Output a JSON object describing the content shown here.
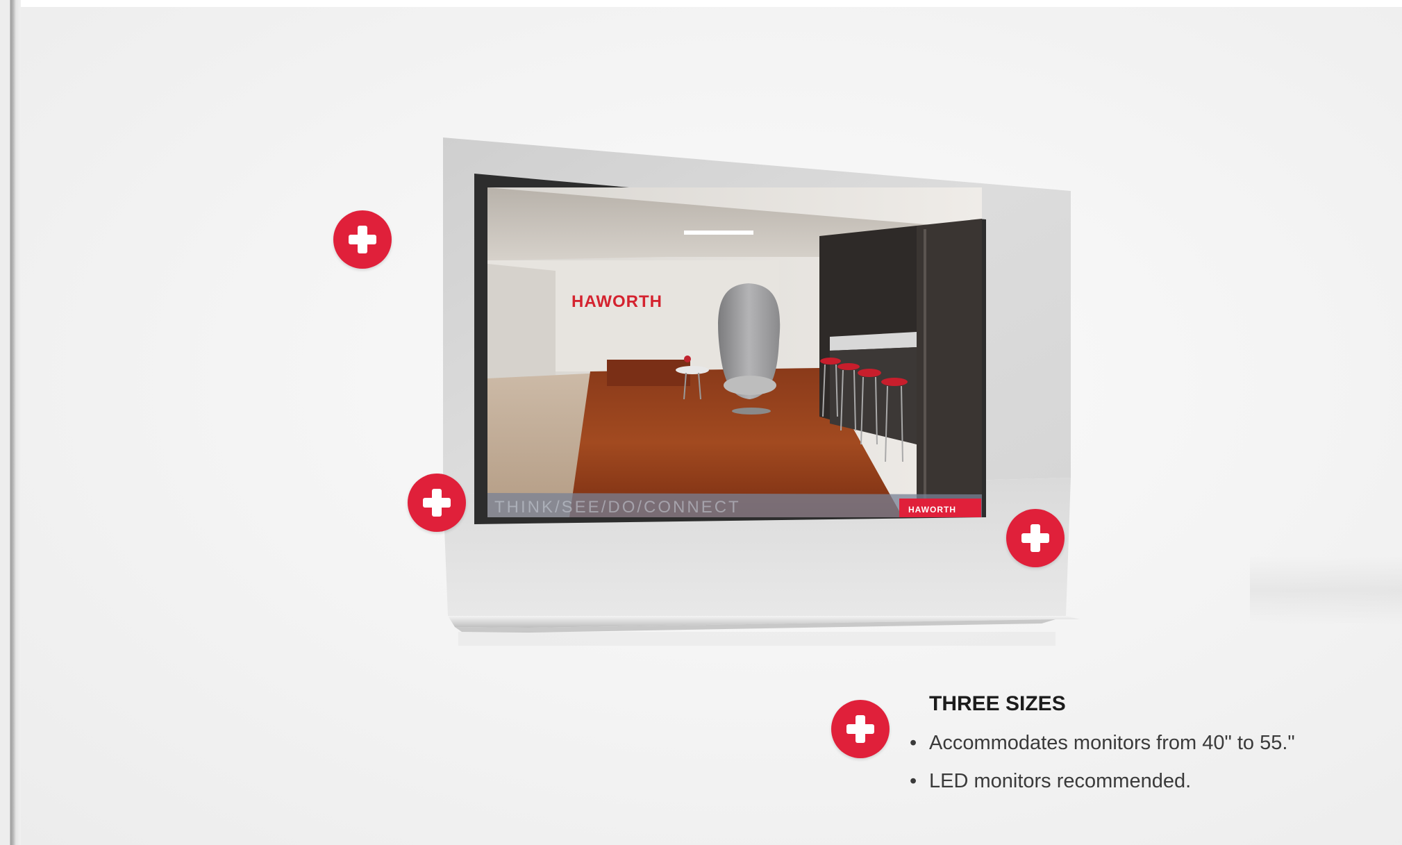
{
  "screen": {
    "colors": {
      "accent": "#e0203a",
      "background": "#f3f3f3",
      "panel": "#d9d9d9",
      "bezel": "#2b2b2b"
    }
  },
  "display": {
    "brand_logo": "HAWORTH",
    "tagline": "THINK/SEE/DO/CONNECT",
    "corner_logo": "HAWORTH"
  },
  "hotspots": [
    {
      "name": "hotspot-top-left",
      "icon": "plus-icon"
    },
    {
      "name": "hotspot-screen-left",
      "icon": "plus-icon"
    },
    {
      "name": "hotspot-screen-right",
      "icon": "plus-icon"
    },
    {
      "name": "hotspot-info",
      "icon": "plus-icon"
    }
  ],
  "info": {
    "title": "THREE SIZES",
    "bullets": [
      "Accommodates monitors from 40\" to 55.\"",
      "LED monitors recommended."
    ],
    "bullet_glyph": "•"
  }
}
